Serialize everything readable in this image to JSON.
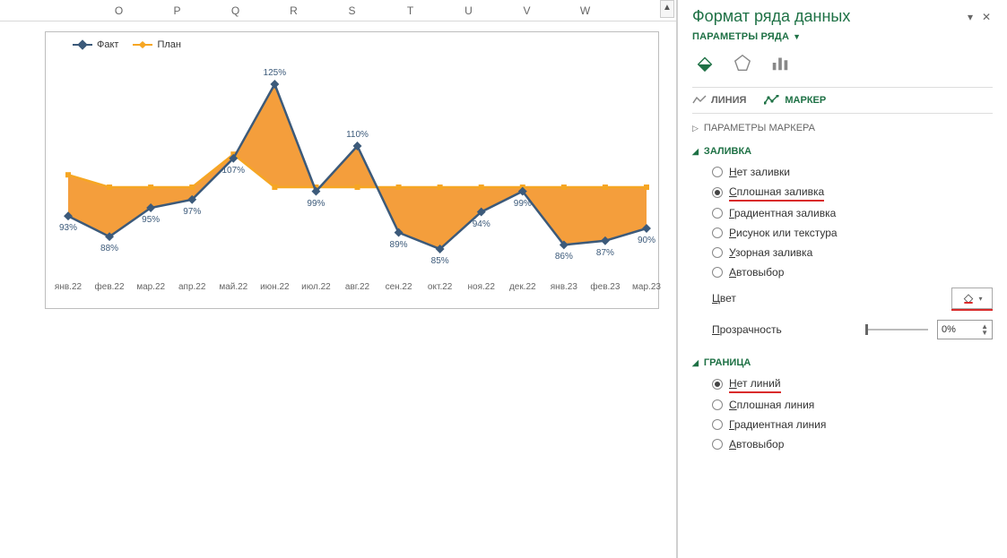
{
  "columns": [
    "O",
    "P",
    "Q",
    "R",
    "S",
    "T",
    "U",
    "V",
    "W"
  ],
  "legend": {
    "fact": "Факт",
    "plan": "План"
  },
  "chart_data": {
    "type": "line",
    "categories": [
      "янв.22",
      "фев.22",
      "мар.22",
      "апр.22",
      "май.22",
      "июн.22",
      "июл.22",
      "авг.22",
      "сен.22",
      "окт.22",
      "ноя.22",
      "дек.22",
      "янв.23",
      "фев.23",
      "мар.23"
    ],
    "series": [
      {
        "name": "Факт",
        "values": [
          93,
          88,
          95,
          97,
          107,
          125,
          99,
          110,
          89,
          85,
          94,
          99,
          86,
          87,
          90
        ],
        "color": "#3c5a7a"
      },
      {
        "name": "План",
        "values": [
          103,
          100,
          100,
          100,
          108,
          100,
          100,
          100,
          100,
          100,
          100,
          100,
          100,
          100,
          100
        ],
        "color": "#f6a623"
      }
    ],
    "ylim": [
      80,
      130
    ],
    "area_fill": "#f28d1a",
    "xlabel": "",
    "ylabel": ""
  },
  "pane": {
    "title": "Формат ряда данных",
    "series_options": "ПАРАМЕТРЫ РЯДА",
    "subtabs": {
      "line": "ЛИНИЯ",
      "marker": "МАРКЕР"
    },
    "sect_marker_params": "ПАРАМЕТРЫ МАРКЕРА",
    "sect_fill": "ЗАЛИВКА",
    "fill_opts": {
      "none": "Нет заливки",
      "solid": "Сплошная заливка",
      "gradient": "Градиентная заливка",
      "picture": "Рисунок или текстура",
      "pattern": "Узорная заливка",
      "auto": "Автовыбор"
    },
    "color_label": "Цвет",
    "transparency_label": "Прозрачность",
    "transparency_value": "0%",
    "sect_border": "ГРАНИЦА",
    "border_opts": {
      "none": "Нет линий",
      "solid": "Сплошная линия",
      "gradient": "Градиентная линия",
      "auto": "Автовыбор"
    }
  }
}
